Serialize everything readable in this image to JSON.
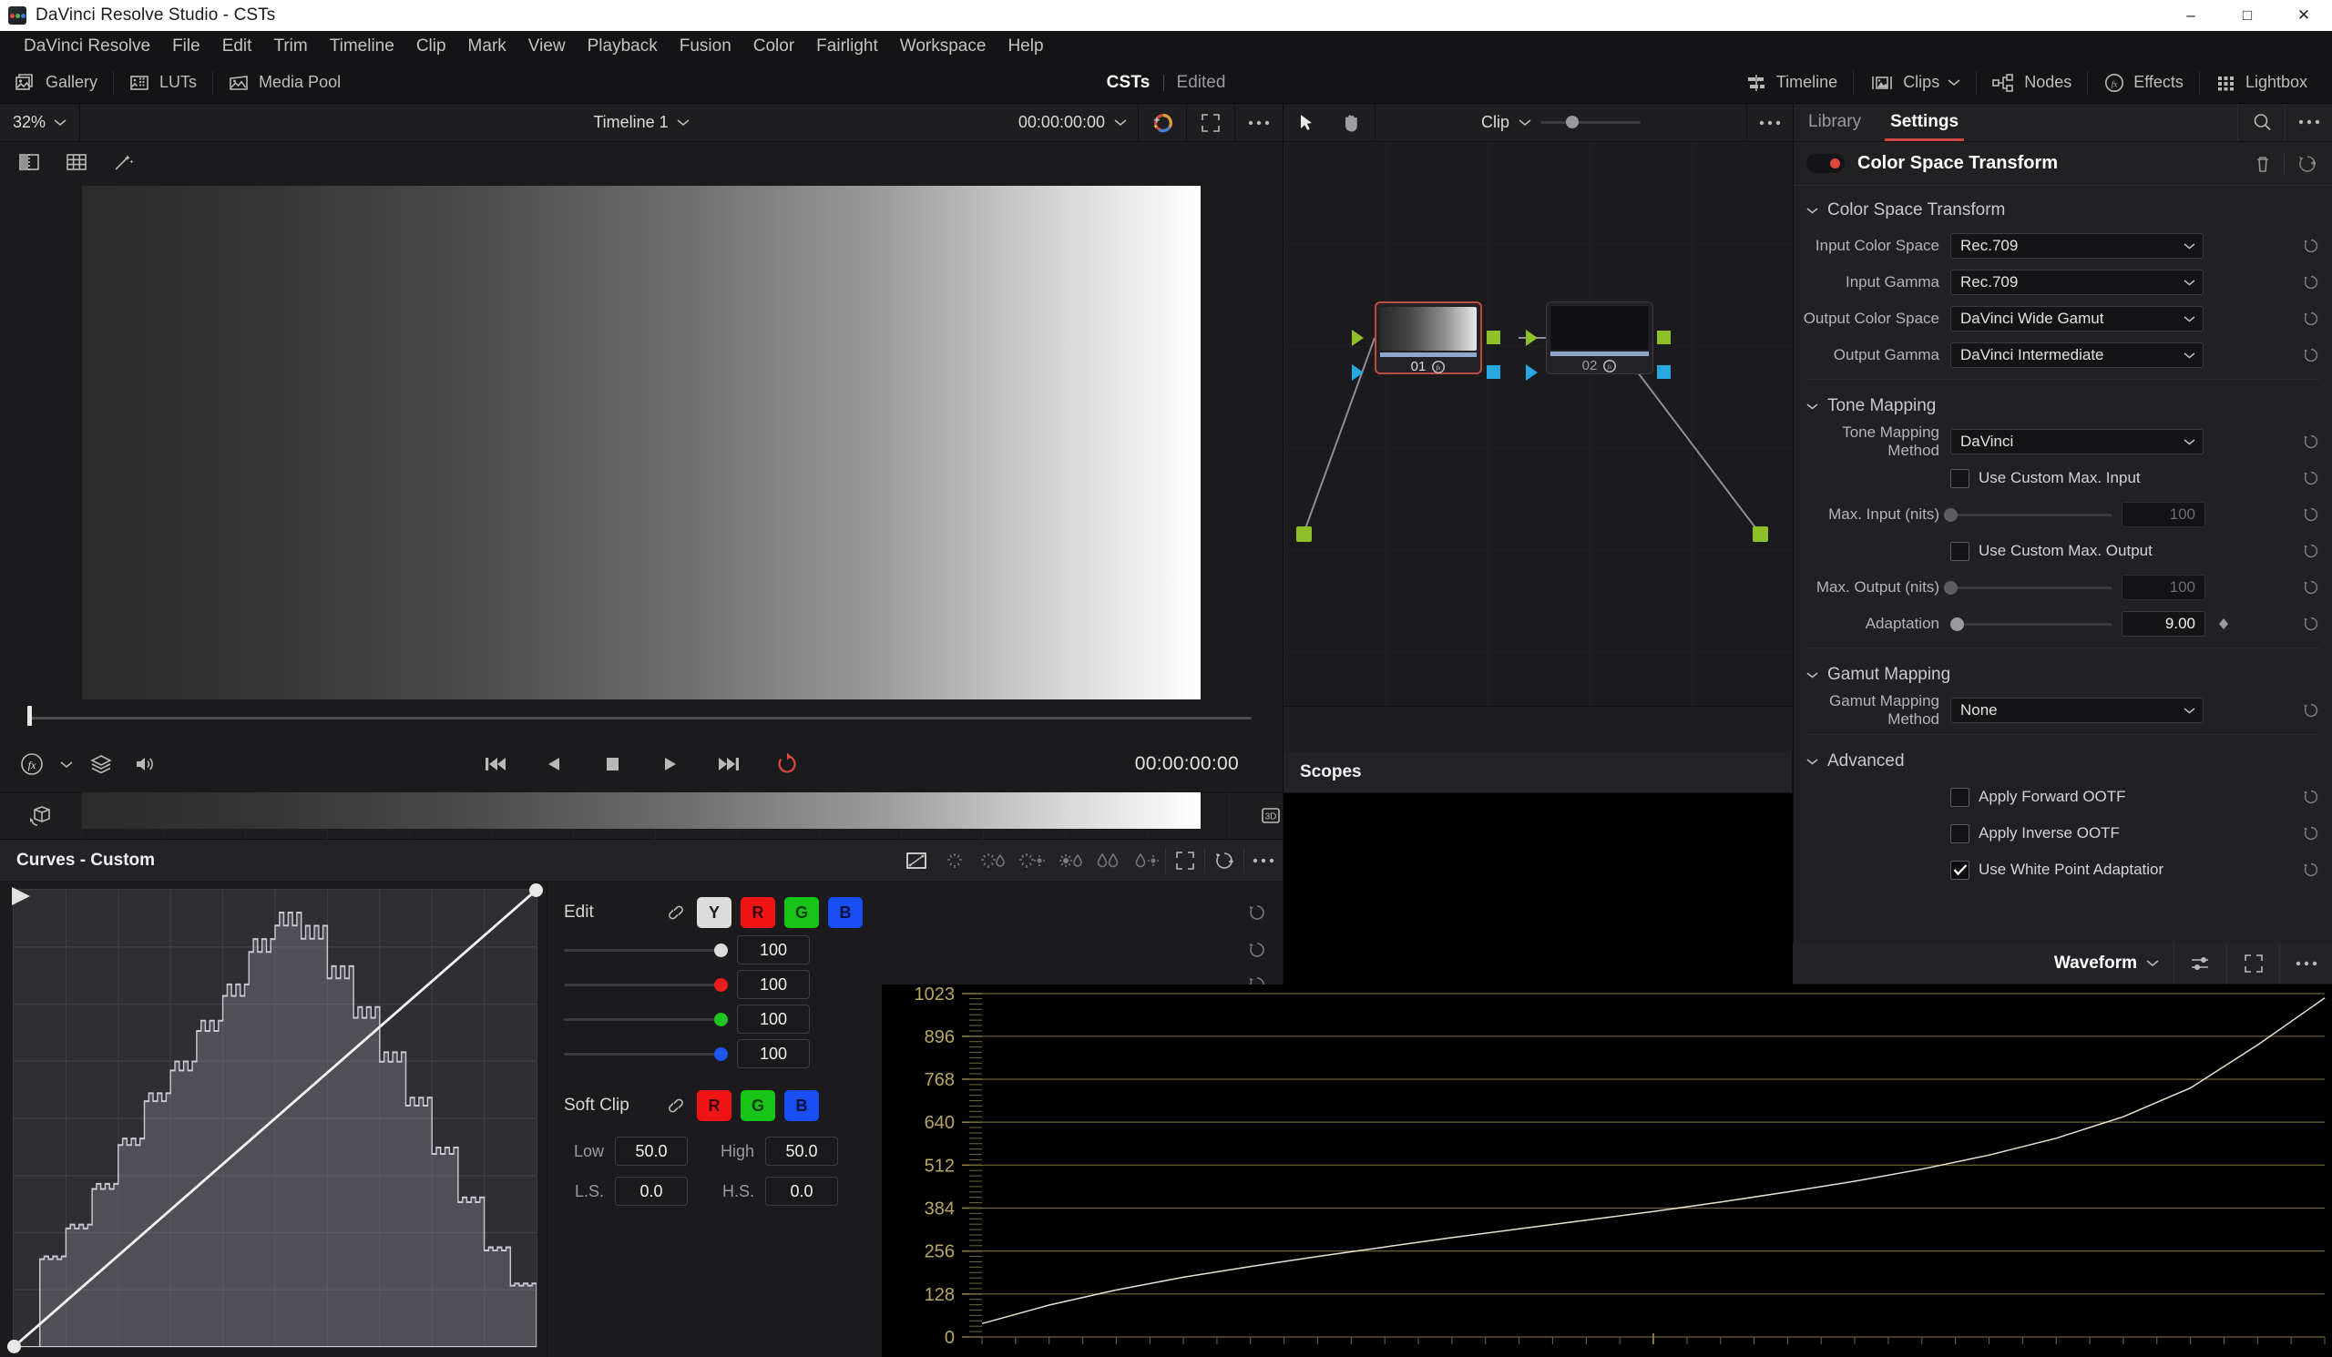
{
  "window": {
    "title": "DaVinci Resolve Studio - CSTs",
    "minimize": "–",
    "maximize": "□",
    "close": "✕"
  },
  "menu": [
    "DaVinci Resolve",
    "File",
    "Edit",
    "Trim",
    "Timeline",
    "Clip",
    "Mark",
    "View",
    "Playback",
    "Fusion",
    "Color",
    "Fairlight",
    "Workspace",
    "Help"
  ],
  "toolbar": {
    "left_items": [
      {
        "label": "Gallery",
        "icon": "gallery-icon"
      },
      {
        "label": "LUTs",
        "icon": "luts-icon"
      },
      {
        "label": "Media Pool",
        "icon": "media-pool-icon"
      }
    ],
    "project": "CSTs",
    "status": "Edited",
    "pages": [
      {
        "label": "Timeline",
        "icon": "timeline-icon"
      },
      {
        "label": "Clips",
        "icon": "clips-icon"
      },
      {
        "label": "Nodes",
        "icon": "nodes-icon"
      },
      {
        "label": "Effects",
        "icon": "effects-fx-icon"
      },
      {
        "label": "Lightbox",
        "icon": "lightbox-icon"
      }
    ]
  },
  "viewer": {
    "zoom": "32%",
    "timeline_name": "Timeline 1",
    "timecode_top": "00:00:00:00",
    "timecode_bottom": "00:00:00:00"
  },
  "node_graph": {
    "scope_label": "Clip",
    "nodes": [
      {
        "number": "01",
        "badge": "fx",
        "selected": true
      },
      {
        "number": "02",
        "badge": "fx",
        "selected": false
      }
    ]
  },
  "curves": {
    "title": "Curves - Custom",
    "edit": {
      "label": "Edit",
      "channels": [
        "Y",
        "R",
        "G",
        "B"
      ],
      "values": [
        "100",
        "100",
        "100",
        "100"
      ]
    },
    "soft_clip": {
      "label": "Soft Clip",
      "channels": [
        "R",
        "G",
        "B"
      ],
      "fields": [
        {
          "caption": "Low",
          "value": "50.0"
        },
        {
          "caption": "High",
          "value": "50.0"
        },
        {
          "caption": "L.S.",
          "value": "0.0"
        },
        {
          "caption": "H.S.",
          "value": "0.0"
        }
      ]
    }
  },
  "scopes": {
    "title": "Scopes",
    "mode": "Waveform"
  },
  "inspector": {
    "tabs": [
      {
        "label": "Library",
        "active": false
      },
      {
        "label": "Settings",
        "active": true
      }
    ],
    "effect_title": "Color Space Transform",
    "sections": [
      {
        "title": "Color Space Transform",
        "rows": [
          {
            "type": "dropdown",
            "label": "Input Color Space",
            "value": "Rec.709"
          },
          {
            "type": "dropdown",
            "label": "Input Gamma",
            "value": "Rec.709"
          },
          {
            "type": "dropdown",
            "label": "Output Color Space",
            "value": "DaVinci Wide Gamut"
          },
          {
            "type": "dropdown",
            "label": "Output Gamma",
            "value": "DaVinci Intermediate"
          }
        ]
      },
      {
        "title": "Tone Mapping",
        "rows": [
          {
            "type": "dropdown",
            "label": "Tone Mapping Method",
            "value": "DaVinci"
          },
          {
            "type": "checkbox",
            "label": "Use Custom Max. Input",
            "checked": false
          },
          {
            "type": "slider",
            "label": "Max. Input (nits)",
            "value": "100",
            "pos": 0,
            "enabled": false
          },
          {
            "type": "checkbox",
            "label": "Use Custom Max. Output",
            "checked": false
          },
          {
            "type": "slider",
            "label": "Max. Output (nits)",
            "value": "100",
            "pos": 0,
            "enabled": false
          },
          {
            "type": "slider",
            "label": "Adaptation",
            "value": "9.00",
            "pos": 4,
            "enabled": true,
            "keyframe": true
          }
        ]
      },
      {
        "title": "Gamut Mapping",
        "rows": [
          {
            "type": "dropdown",
            "label": "Gamut Mapping Method",
            "value": "None"
          }
        ]
      },
      {
        "title": "Advanced",
        "rows": [
          {
            "type": "checkbox",
            "label": "Apply Forward OOTF",
            "checked": false
          },
          {
            "type": "checkbox",
            "label": "Apply Inverse OOTF",
            "checked": false
          },
          {
            "type": "checkbox",
            "label": "Use White Point Adaptatior",
            "checked": true
          }
        ]
      }
    ]
  },
  "chart_data": {
    "type": "line",
    "title": "Waveform",
    "ylabel": "",
    "xlabel": "",
    "ylim": [
      0,
      1023
    ],
    "yticks": [
      0,
      128,
      256,
      384,
      512,
      640,
      768,
      896,
      1023
    ],
    "grid": true,
    "legend": "none",
    "series": [
      {
        "name": "Luma Waveform",
        "x": [
          0,
          0.05,
          0.1,
          0.15,
          0.2,
          0.25,
          0.3,
          0.35,
          0.4,
          0.45,
          0.5,
          0.55,
          0.6,
          0.65,
          0.7,
          0.75,
          0.8,
          0.85,
          0.9,
          0.95,
          1.0
        ],
        "y": [
          40,
          95,
          140,
          178,
          210,
          240,
          268,
          296,
          322,
          348,
          374,
          402,
          432,
          464,
          500,
          542,
          592,
          656,
          742,
          870,
          1010
        ]
      }
    ]
  },
  "curve_chart": {
    "type": "line",
    "title": "Curves - Custom",
    "grid": true,
    "xlim": [
      0,
      1
    ],
    "ylim": [
      0,
      1
    ],
    "series": [
      {
        "name": "Custom Curve",
        "x": [
          0,
          1
        ],
        "y": [
          0,
          1
        ]
      },
      {
        "name": "Histogram",
        "x": [
          0.0,
          0.05,
          0.1,
          0.15,
          0.2,
          0.25,
          0.3,
          0.35,
          0.4,
          0.45,
          0.5,
          0.55,
          0.6,
          0.65,
          0.7,
          0.75,
          0.8,
          0.85,
          0.9,
          0.95,
          1.0
        ],
        "y": [
          0.0,
          0.2,
          0.27,
          0.36,
          0.46,
          0.56,
          0.63,
          0.72,
          0.8,
          0.9,
          0.96,
          0.93,
          0.84,
          0.75,
          0.65,
          0.55,
          0.44,
          0.33,
          0.22,
          0.14,
          0.08
        ]
      }
    ]
  }
}
